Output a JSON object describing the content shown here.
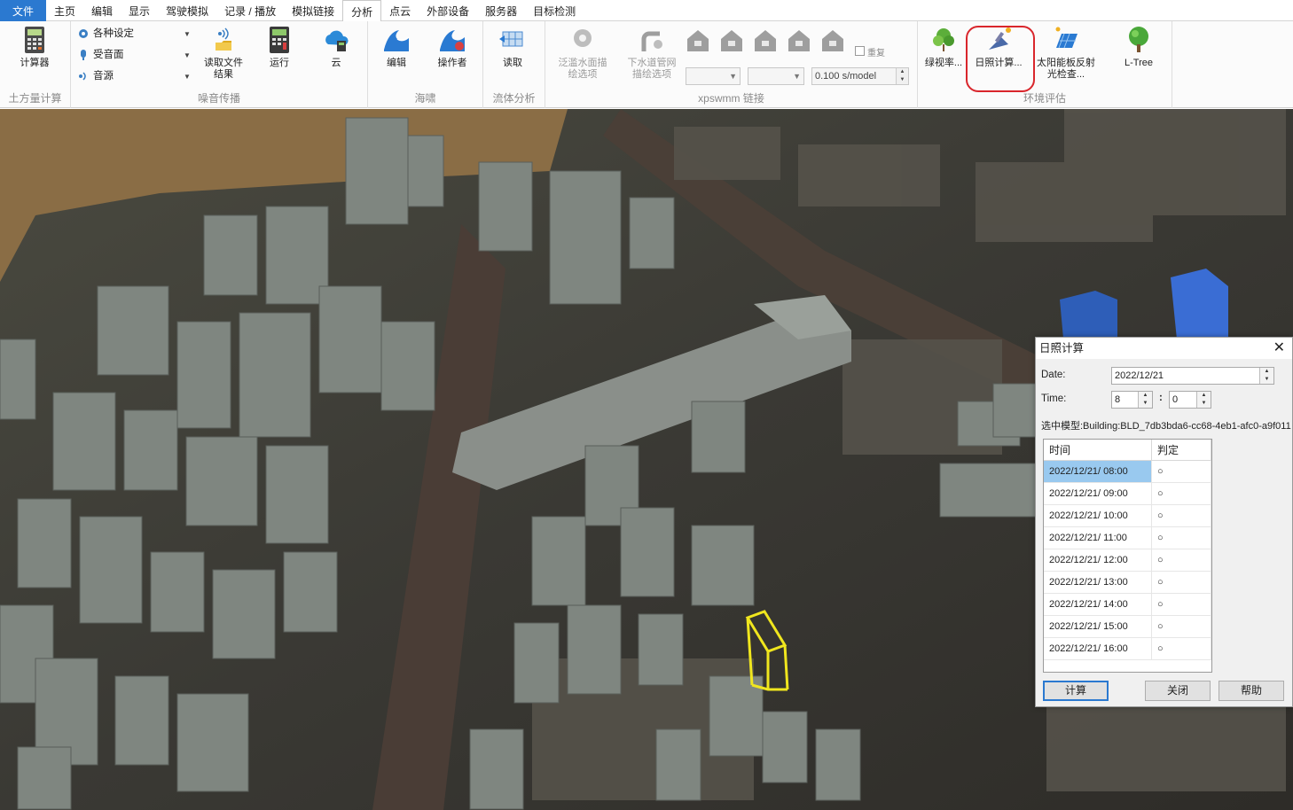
{
  "menu": {
    "file": "文件",
    "tabs": [
      "主页",
      "编辑",
      "显示",
      "驾驶模拟",
      "记录 / 播放",
      "模拟链接",
      "分析",
      "点云",
      "外部设备",
      "服务器",
      "目标检测"
    ],
    "active_index": 6
  },
  "ribbon": {
    "earthwork": {
      "calc_label": "计算器",
      "group_label": "土方量计算"
    },
    "noise": {
      "settings": "各种设定",
      "receiver": "受音面",
      "source": "音源",
      "read_result": "读取文件\n结果",
      "run": "运行",
      "cloud": "云",
      "group_label": "噪音传播"
    },
    "tsunami": {
      "edit": "编辑",
      "operator": "操作者",
      "group_label": "海啸"
    },
    "fluid": {
      "read": "读取",
      "group_label": "流体分析"
    },
    "xpswmm": {
      "flood_area": "泛滥水面描\n绘选项",
      "sewer_network": "下水道管网\n描绘选项",
      "repeat_label": "重复",
      "speed_value": "0.100 s/model",
      "group_label": "xpswmm 链接"
    },
    "environment": {
      "green_view": "绿视率...",
      "sunlight": "日照计算...",
      "solar_glare": "太阳能板反射\n光检查...",
      "ltree": "L-Tree",
      "group_label": "环境评估"
    }
  },
  "dialog": {
    "title": "日照计算",
    "date_label": "Date:",
    "date_value": "2022/12/21",
    "time_label": "Time:",
    "hour_value": "8",
    "minute_value": "0",
    "time_sep": ":",
    "selected_model": "选中模型:Building:BLD_7db3bda6-cc68-4eb1-afc0-a9f011",
    "columns": [
      "时间",
      "判定"
    ],
    "rows": [
      {
        "time": "2022/12/21/ 08:00",
        "result": "○"
      },
      {
        "time": "2022/12/21/ 09:00",
        "result": "○"
      },
      {
        "time": "2022/12/21/ 10:00",
        "result": "○"
      },
      {
        "time": "2022/12/21/ 11:00",
        "result": "○"
      },
      {
        "time": "2022/12/21/ 12:00",
        "result": "○"
      },
      {
        "time": "2022/12/21/ 13:00",
        "result": "○"
      },
      {
        "time": "2022/12/21/ 14:00",
        "result": "○"
      },
      {
        "time": "2022/12/21/ 15:00",
        "result": "○"
      },
      {
        "time": "2022/12/21/ 16:00",
        "result": "○"
      }
    ],
    "buttons": {
      "calc": "计算",
      "close": "关闭",
      "help": "帮助"
    }
  },
  "colors": {
    "accent": "#2b79d0",
    "highlight_ring": "#d9262c",
    "selected_building": "#f0e61e",
    "selection_row": "#99c9ef"
  }
}
